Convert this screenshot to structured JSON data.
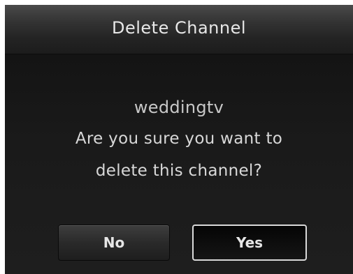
{
  "dialog": {
    "title": "Delete Channel",
    "channel_name": "weddingtv",
    "question_line1": "Are you sure you want to",
    "question_line2": "delete this channel?",
    "buttons": {
      "no_label": "No",
      "yes_label": "Yes"
    },
    "focused_button": "Yes"
  }
}
